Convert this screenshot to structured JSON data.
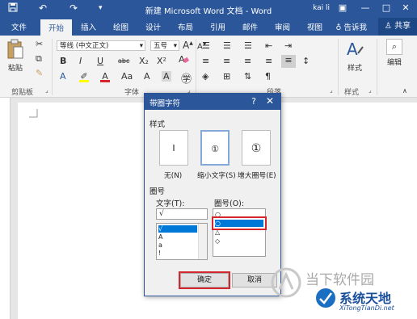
{
  "window": {
    "title": "新建 Microsoft Word 文档 - Word",
    "user": "kai li",
    "quick_access": [
      "save",
      "undo",
      "redo",
      "customize"
    ]
  },
  "tabs": {
    "items": [
      "文件",
      "开始",
      "插入",
      "绘图",
      "设计",
      "布局",
      "引用",
      "邮件",
      "审阅",
      "视图"
    ],
    "active": "开始",
    "tell_me": "告诉我",
    "share": "共享"
  },
  "ribbon": {
    "clipboard": {
      "paste": "粘贴",
      "label": "剪贴板"
    },
    "font": {
      "font_name": "等线 (中文正文)",
      "font_size": "五号",
      "label": "字体",
      "row1": [
        "B",
        "I",
        "U",
        "abc",
        "X₂",
        "X²"
      ],
      "row2": [
        "A",
        "A",
        "Aa",
        "A",
        "A",
        "㊫"
      ],
      "grow": "A",
      "shrink": "A",
      "case": "Aa",
      "clear": "A"
    },
    "paragraph": {
      "label": "段落"
    },
    "styles": {
      "button": "样式",
      "label": "样式"
    },
    "editing": {
      "button": "编辑"
    },
    "colors": {
      "accent": "#2b579a",
      "highlight": "#ffff00",
      "font_color": "#d6262d"
    }
  },
  "dialog": {
    "title": "带圈字符",
    "help": "?",
    "close": "✕",
    "style_section": "样式",
    "styles": [
      {
        "glyph": "I",
        "caption": "无(N)"
      },
      {
        "glyph": "①",
        "caption": "缩小文字(S)"
      },
      {
        "glyph": "①",
        "caption": "增大圈号(E)"
      }
    ],
    "selected_style": "缩小文字(S)",
    "circle_section": "圈号",
    "text_label": "文字(T):",
    "text_value": "√",
    "text_list": [
      "√",
      "A",
      "a",
      "!"
    ],
    "text_selected": "√",
    "ring_label": "圈号(O):",
    "ring_list": [
      "○",
      "○",
      "△",
      "◇"
    ],
    "ring_selected": "○",
    "ok": "确定",
    "cancel": "取消"
  },
  "watermark": {
    "top_text": "当下软件园",
    "brand": "系统天地",
    "url": "XiTongTianDi.net"
  }
}
